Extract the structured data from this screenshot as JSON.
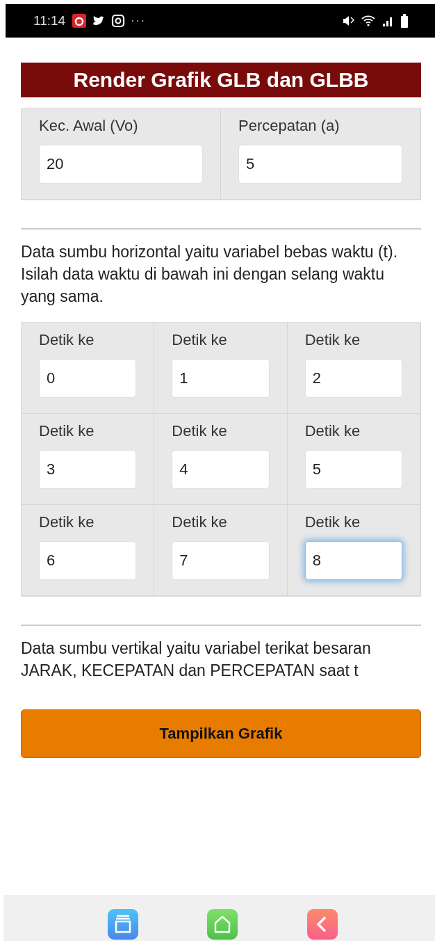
{
  "status_bar": {
    "time": "11:14",
    "more": "···"
  },
  "title": "Render Grafik GLB dan GLBB",
  "params": [
    {
      "label": "Kec. Awal (Vo)",
      "value": "20"
    },
    {
      "label": "Percepatan (a)",
      "value": "5"
    }
  ],
  "horizontal_note": "Data sumbu horizontal yaitu variabel bebas waktu (t). Isilah data waktu di bawah ini dengan selang waktu yang sama.",
  "time_fields": [
    {
      "label": "Detik ke",
      "value": "0",
      "focused": false
    },
    {
      "label": "Detik ke",
      "value": "1",
      "focused": false
    },
    {
      "label": "Detik ke",
      "value": "2",
      "focused": false
    },
    {
      "label": "Detik ke",
      "value": "3",
      "focused": false
    },
    {
      "label": "Detik ke",
      "value": "4",
      "focused": false
    },
    {
      "label": "Detik ke",
      "value": "5",
      "focused": false
    },
    {
      "label": "Detik ke",
      "value": "6",
      "focused": false
    },
    {
      "label": "Detik ke",
      "value": "7",
      "focused": false
    },
    {
      "label": "Detik ke",
      "value": "8",
      "focused": true
    }
  ],
  "vertical_note": "Data sumbu vertikal yaitu variabel terikat besaran JARAK, KECEPATAN dan PERCEPATAN saat t",
  "submit_button": "Tampilkan Grafik"
}
